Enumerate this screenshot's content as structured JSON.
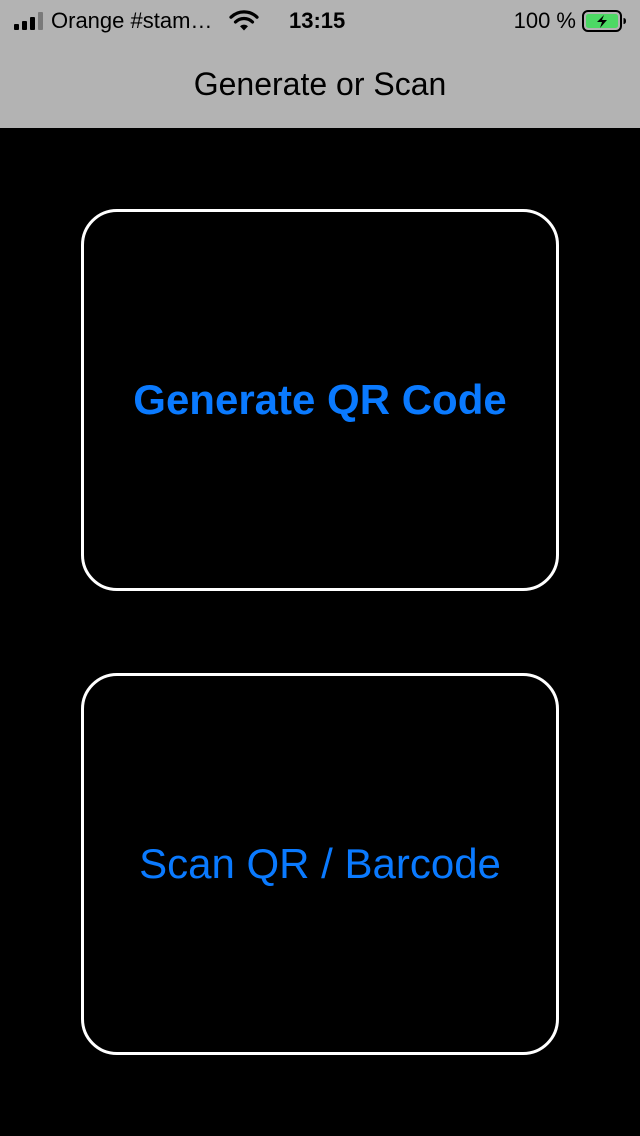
{
  "status_bar": {
    "carrier": "Orange #stam…",
    "time": "13:15",
    "battery_percent": "100 %",
    "icons": {
      "signal": "cellular-signal-icon",
      "wifi": "wifi-icon",
      "battery": "battery-charging-icon"
    },
    "battery_level": 1.0
  },
  "nav": {
    "title": "Generate or Scan"
  },
  "actions": {
    "generate_label": "Generate QR Code",
    "scan_label": "Scan QR / Barcode"
  },
  "colors": {
    "accent": "#0a7aff",
    "nav_background": "#b3b3b3",
    "background": "#000000",
    "card_border": "#ffffff",
    "battery_fill": "#4cd964"
  }
}
